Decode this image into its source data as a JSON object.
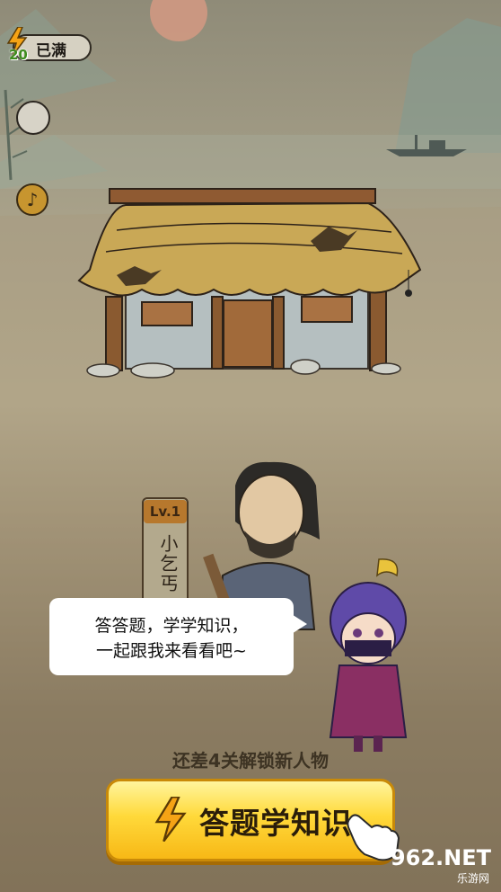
{
  "energy": {
    "count": "20",
    "status": "已满"
  },
  "npc": {
    "level": "Lv.1",
    "name": "小乞丐"
  },
  "speech": {
    "line1": "答答题，学学知识，",
    "line2": "一起跟我来看看吧~"
  },
  "unlock_hint": "还差4关解锁新人物",
  "main_button": {
    "label": "答题学知识"
  },
  "watermark": {
    "brand": "962.NET",
    "sub": "乐游网"
  },
  "colors": {
    "button_yellow": "#ffd93a",
    "bolt_orange": "#f5a315",
    "energy_green": "#3e8c1f"
  }
}
